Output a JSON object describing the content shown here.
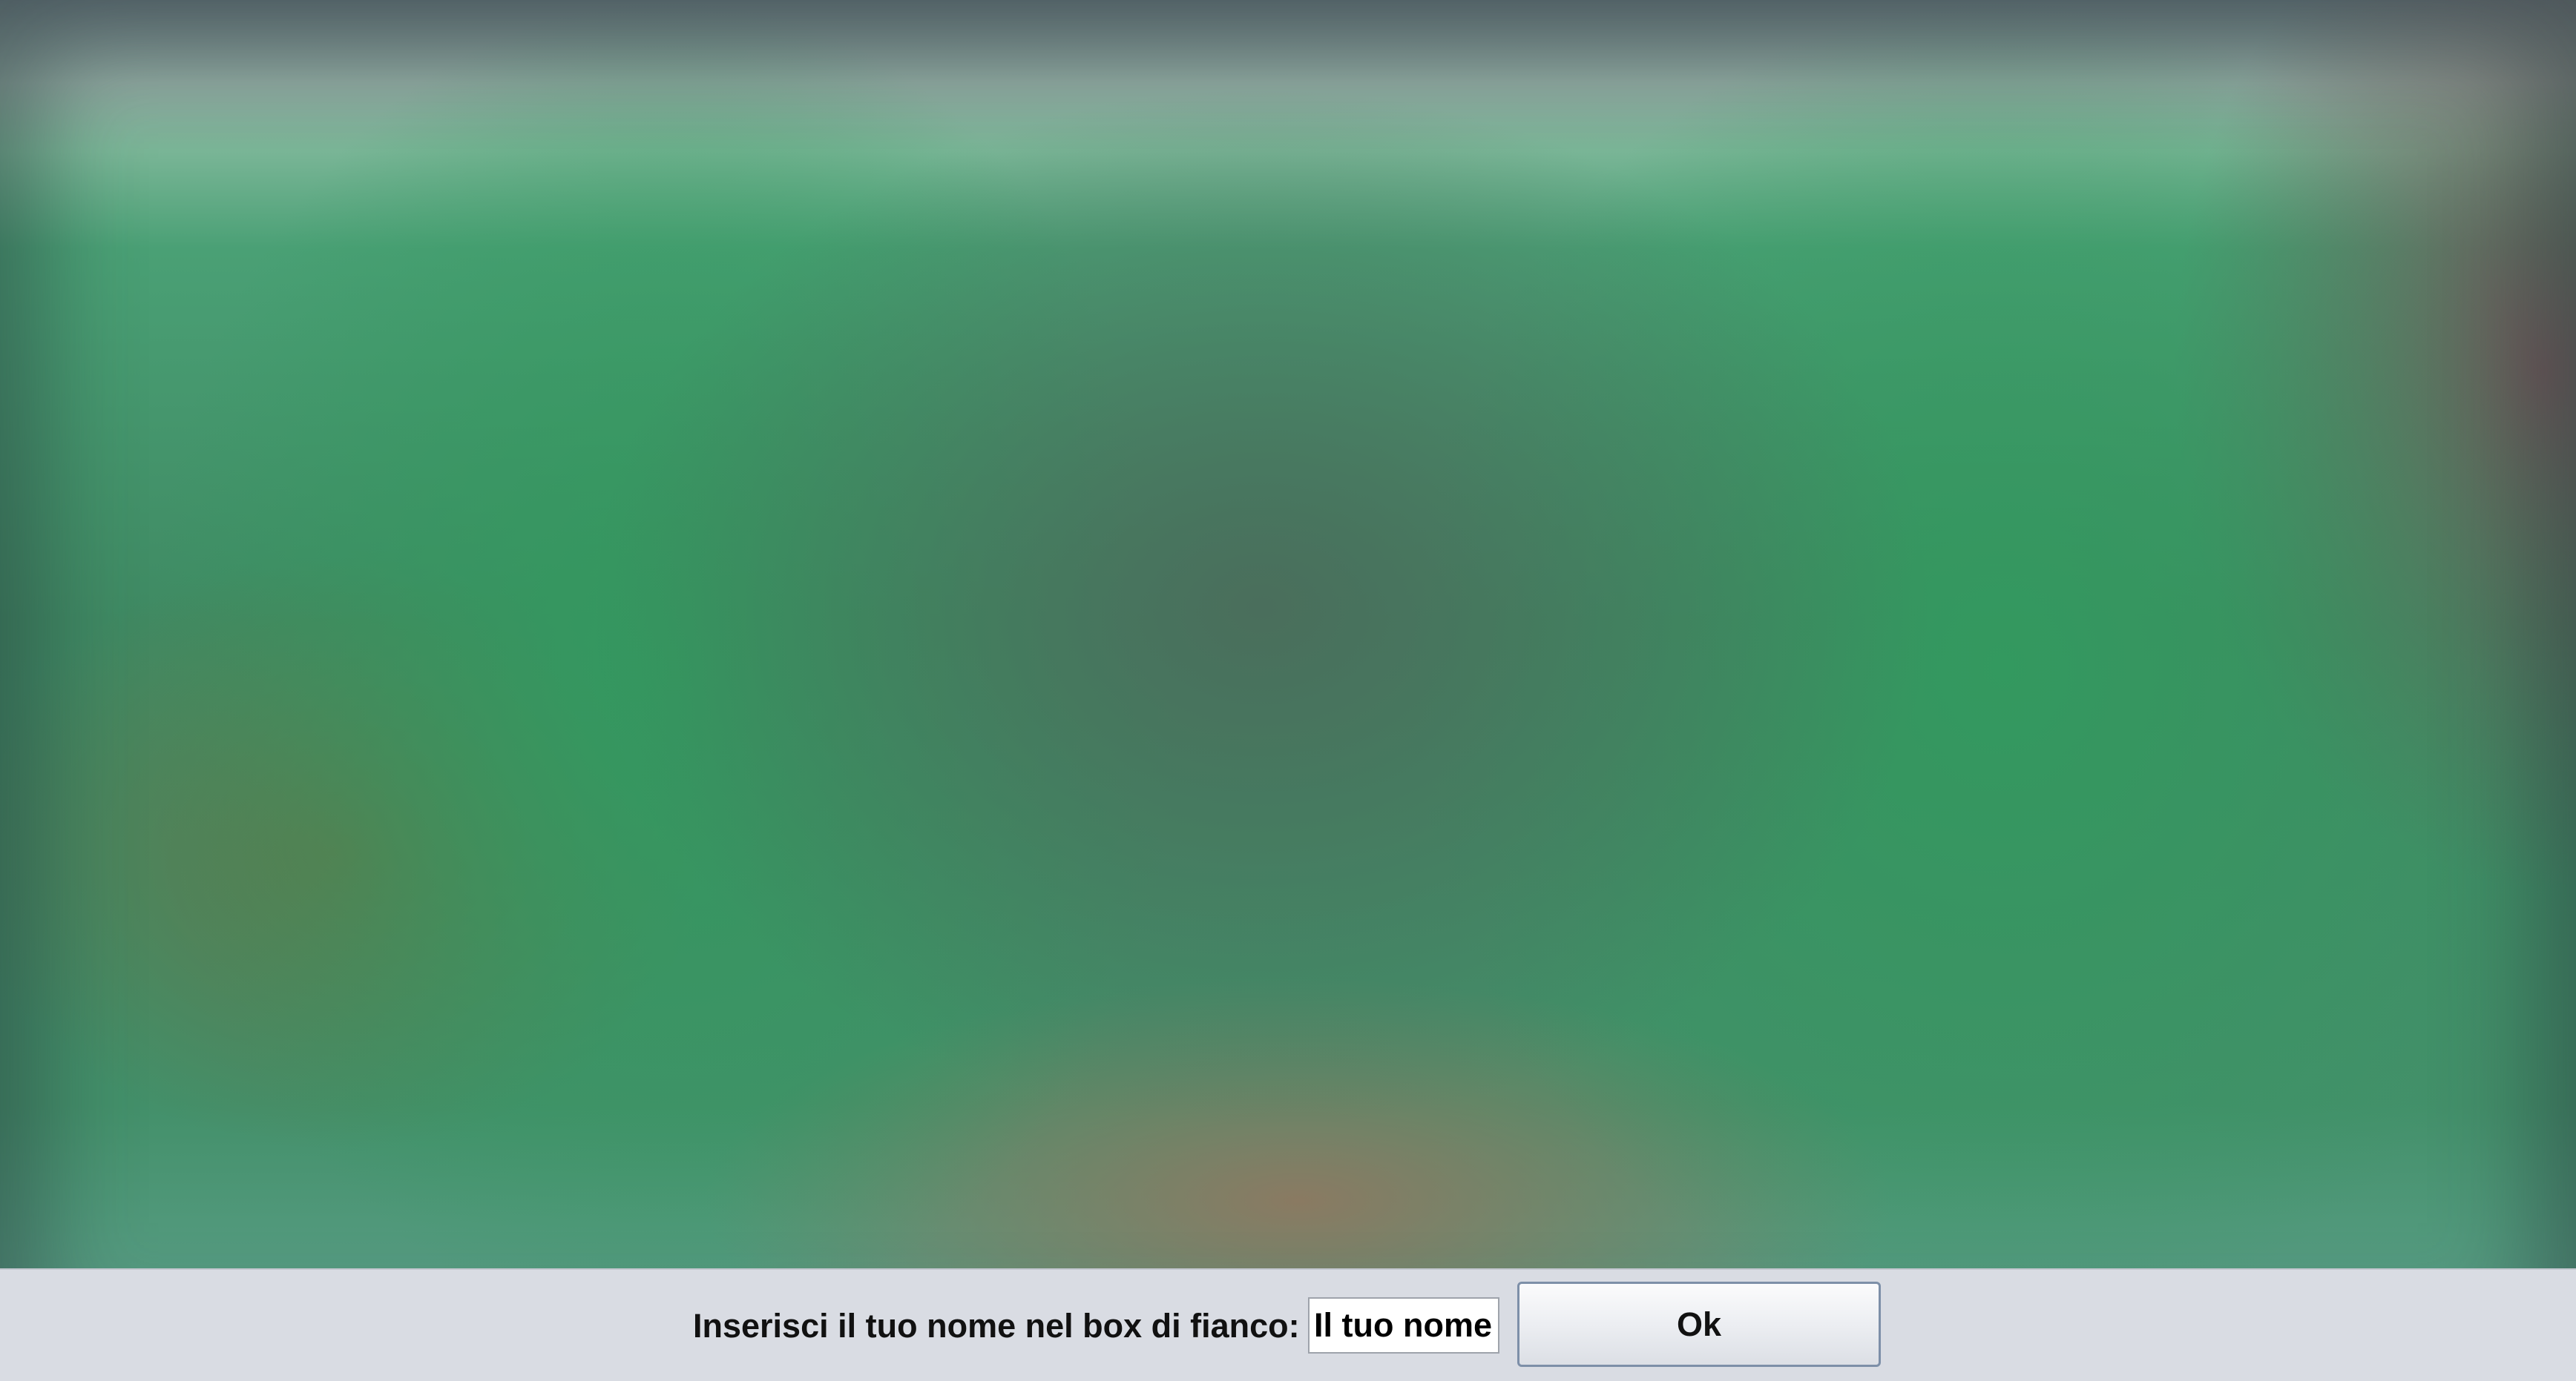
{
  "dialog": {
    "prompt_label": "Inserisci il tuo nome nel box di fianco:",
    "name_input_value": "Il tuo nome",
    "ok_label": "Ok"
  },
  "colors": {
    "background_green": "#3f8a63",
    "bar_background": "#d9dce3",
    "button_border": "#7d8fa8"
  }
}
